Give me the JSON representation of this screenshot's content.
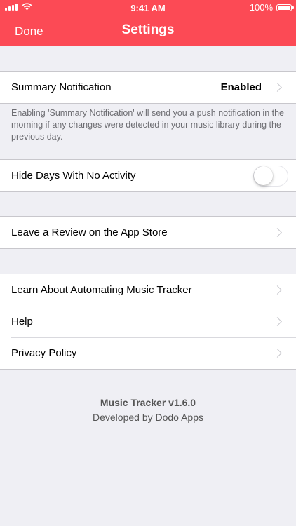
{
  "status_bar": {
    "time": "9:41 AM",
    "battery": "100%",
    "wifi_icon": "wifi-icon",
    "signal_icon": "signal-icon",
    "battery_icon": "battery-icon"
  },
  "header": {
    "done_label": "Done",
    "title": "Settings",
    "background": "#fc4a55"
  },
  "notifications": {
    "summary_label": "Summary Notification",
    "summary_value": "Enabled",
    "footnote": "Enabling 'Summary Notification' will send you a push notification in the morning if any changes were detected in your music library during the previous day."
  },
  "activity": {
    "hide_days_label": "Hide Days With No Activity",
    "hide_days_enabled": false
  },
  "review": {
    "label": "Leave a Review on the App Store"
  },
  "info": {
    "items": [
      {
        "label": "Learn About Automating Music Tracker"
      },
      {
        "label": "Help"
      },
      {
        "label": "Privacy Policy"
      }
    ]
  },
  "app": {
    "version": "Music Tracker v1.6.0",
    "developer": "Developed by Dodo Apps"
  }
}
